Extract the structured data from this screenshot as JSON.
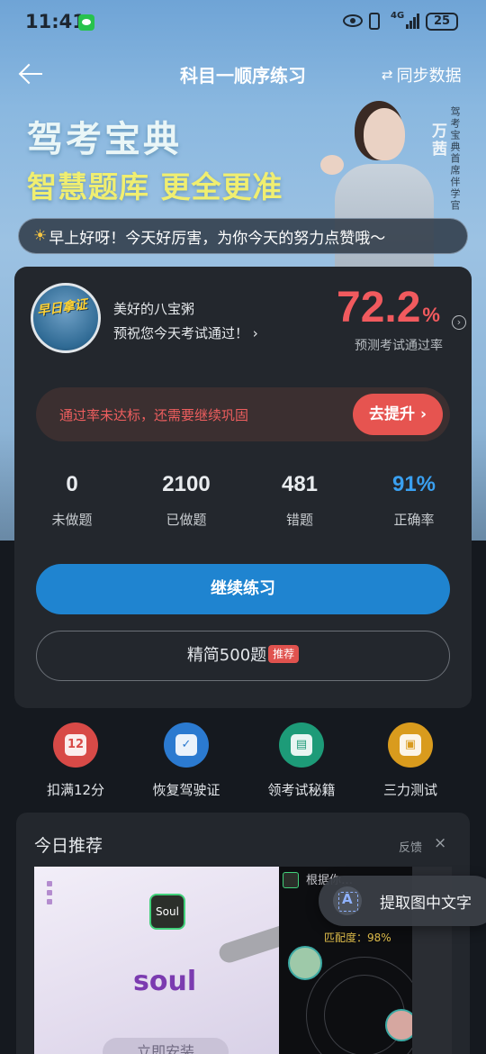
{
  "status_bar": {
    "time": "11:41",
    "network": "4G",
    "battery": "25",
    "icons": [
      "wechat-icon",
      "eye-icon",
      "vibrate-icon",
      "signal-icon"
    ]
  },
  "nav": {
    "title": "科目一顺序练习",
    "sync_label": "同步数据",
    "sync_icon": "⇄"
  },
  "banner": {
    "title": "驾考宝典",
    "slogan": "智慧题库 更全更准",
    "spokesperson_name": "万茜",
    "spokesperson_role": "驾考宝典首席伴学官"
  },
  "greeting": {
    "text": "早上好呀！今天好厉害，为你今天的努力点赞哦～"
  },
  "card": {
    "badge_label": "早日拿证",
    "badge_line1": "美好的八宝粥",
    "badge_line2": "预祝您今天考试通过！ ›",
    "pass_rate": "72.2",
    "pass_rate_unit": "%",
    "pass_rate_label": "预测考试通过率",
    "warning_text": "通过率未达标，还需要继续巩固",
    "improve_button": "去提升 ›",
    "stats": [
      {
        "value": "0",
        "label": "未做题"
      },
      {
        "value": "2100",
        "label": "已做题"
      },
      {
        "value": "481",
        "label": "错题"
      },
      {
        "value": "91%",
        "label": "正确率"
      }
    ],
    "continue_button": "继续练习",
    "lite_button": "精简500题",
    "lite_tag": "推荐",
    "colors": {
      "pass_rate": "#f15a5e",
      "accuracy": "#3aa0f0",
      "continue_button": "#1f84d0",
      "improve_button": "#e65450"
    }
  },
  "tools": [
    {
      "label": "扣满12分",
      "icon": "calendar-12-icon",
      "color": "#d84a47",
      "glyph": "12"
    },
    {
      "label": "恢复驾驶证",
      "icon": "license-icon",
      "color": "#2b7ad0",
      "glyph": "✓"
    },
    {
      "label": "领考试秘籍",
      "icon": "book-icon",
      "color": "#1d9b78",
      "glyph": "▤"
    },
    {
      "label": "三力测试",
      "icon": "test-icon",
      "color": "#d99b1d",
      "glyph": "▣"
    }
  ],
  "recommend": {
    "title": "今日推荐",
    "feedback": "反馈",
    "close": "×",
    "ad_logo": "Soul",
    "ad_brand": "soul",
    "ad_install": "立即安装",
    "ad_right_title": "根据你…",
    "ad_match": "匹配度：98%"
  },
  "ocr": {
    "label": "提取图中文字"
  }
}
